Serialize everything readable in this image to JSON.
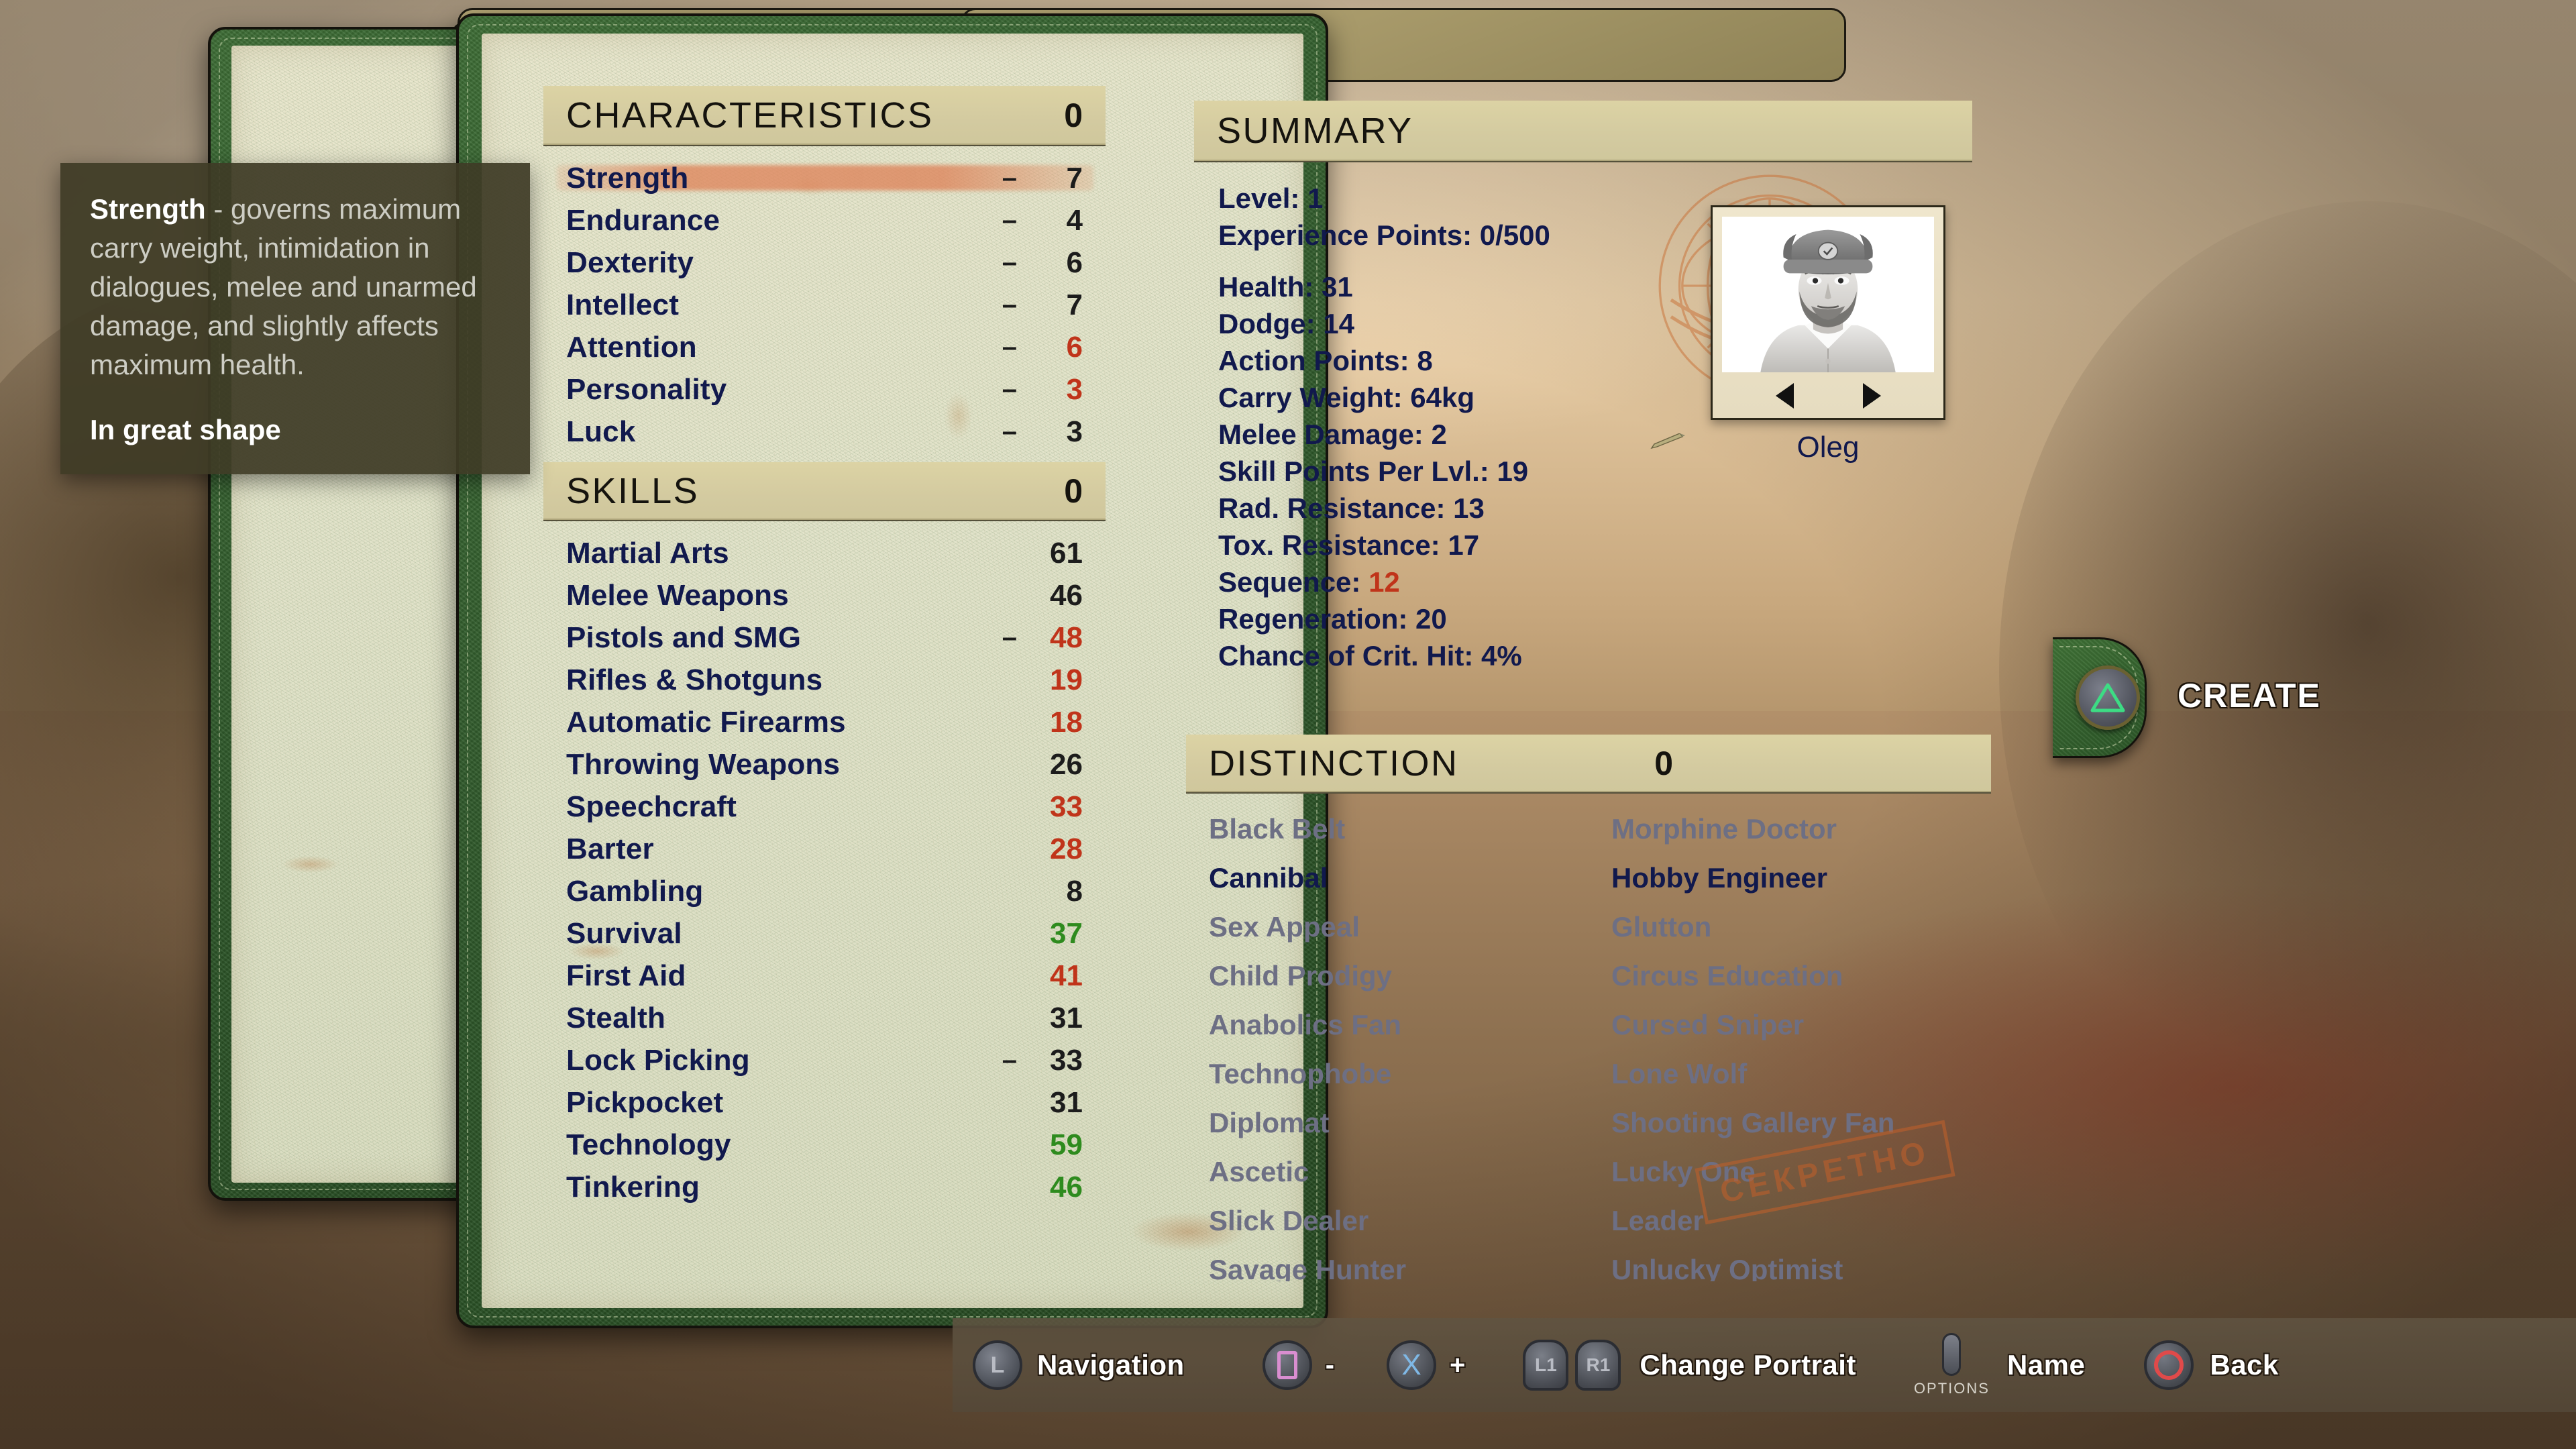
{
  "tooltip": {
    "term": "Strength",
    "body": " - governs maximum carry weight, intimidation in dialogues, melee and unarmed damage, and slightly affects maximum health.",
    "status": "In great shape"
  },
  "characteristics": {
    "title": "CHARACTERISTICS",
    "points": "0",
    "rows": [
      {
        "name": "Strength",
        "dash": "–",
        "value": "7",
        "color": "#1c1c1c",
        "selected": true
      },
      {
        "name": "Endurance",
        "dash": "–",
        "value": "4",
        "color": "#1c1c1c",
        "selected": false
      },
      {
        "name": "Dexterity",
        "dash": "–",
        "value": "6",
        "color": "#1c1c1c",
        "selected": false
      },
      {
        "name": "Intellect",
        "dash": "–",
        "value": "7",
        "color": "#1c1c1c",
        "selected": false
      },
      {
        "name": "Attention",
        "dash": "–",
        "value": "6",
        "color": "#c0341a",
        "selected": false
      },
      {
        "name": "Personality",
        "dash": "–",
        "value": "3",
        "color": "#c0341a",
        "selected": false
      },
      {
        "name": "Luck",
        "dash": "–",
        "value": "3",
        "color": "#1c1c1c",
        "selected": false
      }
    ]
  },
  "skills": {
    "title": "SKILLS",
    "points": "0",
    "rows": [
      {
        "name": "Martial Arts",
        "dash": "",
        "value": "61",
        "color": "#1c1c1c"
      },
      {
        "name": "Melee Weapons",
        "dash": "",
        "value": "46",
        "color": "#1c1c1c"
      },
      {
        "name": "Pistols and SMG",
        "dash": "–",
        "value": "48",
        "color": "#c0341a"
      },
      {
        "name": "Rifles & Shotguns",
        "dash": "",
        "value": "19",
        "color": "#c0341a"
      },
      {
        "name": "Automatic Firearms",
        "dash": "",
        "value": "18",
        "color": "#c0341a"
      },
      {
        "name": "Throwing Weapons",
        "dash": "",
        "value": "26",
        "color": "#1c1c1c"
      },
      {
        "name": "Speechcraft",
        "dash": "",
        "value": "33",
        "color": "#c0341a"
      },
      {
        "name": "Barter",
        "dash": "",
        "value": "28",
        "color": "#c0341a"
      },
      {
        "name": "Gambling",
        "dash": "",
        "value": "8",
        "color": "#1c1c1c"
      },
      {
        "name": "Survival",
        "dash": "",
        "value": "37",
        "color": "#2e8b1e"
      },
      {
        "name": "First Aid",
        "dash": "",
        "value": "41",
        "color": "#c0341a"
      },
      {
        "name": "Stealth",
        "dash": "",
        "value": "31",
        "color": "#1c1c1c"
      },
      {
        "name": "Lock Picking",
        "dash": "–",
        "value": "33",
        "color": "#1c1c1c"
      },
      {
        "name": "Pickpocket",
        "dash": "",
        "value": "31",
        "color": "#1c1c1c"
      },
      {
        "name": "Technology",
        "dash": "",
        "value": "59",
        "color": "#2e8b1e"
      },
      {
        "name": "Tinkering",
        "dash": "",
        "value": "46",
        "color": "#2e8b1e"
      }
    ]
  },
  "summary": {
    "title": "SUMMARY",
    "lines_top": [
      "Level: 1",
      "Experience Points: 0/500"
    ],
    "lines_main": [
      {
        "text": "Health: 31",
        "highlight": null
      },
      {
        "text": "Dodge: 14",
        "highlight": null
      },
      {
        "text": "Action Points: 8",
        "highlight": null
      },
      {
        "text": "Carry Weight: 64kg",
        "highlight": null
      },
      {
        "text": "Melee Damage: 2",
        "highlight": null
      },
      {
        "text": "Skill Points Per Lvl.: 19",
        "highlight": null
      },
      {
        "text": "Rad. Resistance: 13",
        "highlight": null
      },
      {
        "text": "Tox. Resistance: 17",
        "highlight": null
      },
      {
        "text": "Sequence: ",
        "highlight": "12"
      },
      {
        "text": "Regeneration: 20",
        "highlight": null
      },
      {
        "text": "Chance of Crit. Hit: 4%",
        "highlight": null
      }
    ],
    "portrait_name": "Oleg",
    "prev_icon": "left-arrow-icon",
    "next_icon": "right-arrow-icon"
  },
  "distinction": {
    "title": "DISTINCTION",
    "points": "0",
    "left_column": [
      {
        "label": "Black Belt",
        "active": false
      },
      {
        "label": "Cannibal",
        "active": true
      },
      {
        "label": "Sex Appeal",
        "active": false
      },
      {
        "label": "Child Prodigy",
        "active": false
      },
      {
        "label": "Anabolics Fan",
        "active": false
      },
      {
        "label": "Technophobe",
        "active": false
      },
      {
        "label": "Diplomat",
        "active": false
      },
      {
        "label": "Ascetic",
        "active": false
      },
      {
        "label": "Slick Dealer",
        "active": false
      },
      {
        "label": "Savage Hunter",
        "active": false
      }
    ],
    "right_column": [
      {
        "label": "Morphine Doctor",
        "active": false
      },
      {
        "label": "Hobby Engineer",
        "active": true
      },
      {
        "label": "Glutton",
        "active": false
      },
      {
        "label": "Circus Education",
        "active": false
      },
      {
        "label": "Cursed Sniper",
        "active": false
      },
      {
        "label": "Lone Wolf",
        "active": false
      },
      {
        "label": "Shooting Gallery Fan",
        "active": false
      },
      {
        "label": "Lucky One",
        "active": false
      },
      {
        "label": "Leader",
        "active": false
      },
      {
        "label": "Unlucky Optimist",
        "active": false
      }
    ],
    "stamp": "СЕКРЕТНО"
  },
  "create_tab": {
    "label": "CREATE",
    "button_glyph": "triangle-button-icon",
    "accent": "#3ddc84"
  },
  "bottom_bar": {
    "hints": [
      {
        "icon": "left-stick-icon",
        "glyph": "L",
        "label": "Navigation"
      },
      {
        "icon": "square-button-icon",
        "glyph": "",
        "label": "-"
      },
      {
        "icon": "cross-button-icon",
        "glyph": "X",
        "label": "+"
      },
      {
        "icon": "l1-r1-bumper-icon",
        "glyph": "L1",
        "glyph2": "R1",
        "label": "Change Portrait"
      },
      {
        "icon": "options-button-icon",
        "glyph": "",
        "caption": "OPTIONS",
        "label": "Name"
      },
      {
        "icon": "circle-button-icon",
        "glyph": "",
        "label": "Back"
      }
    ]
  },
  "colors": {
    "red": "#c0341a",
    "green": "#2e8b1e",
    "navy": "#11194d",
    "dark": "#1c1c1c",
    "inactive": "#6d6f84",
    "cover_green": "#2c5528",
    "paper": "#e2e3ca",
    "stamp_orange": "#bb5f2c"
  }
}
